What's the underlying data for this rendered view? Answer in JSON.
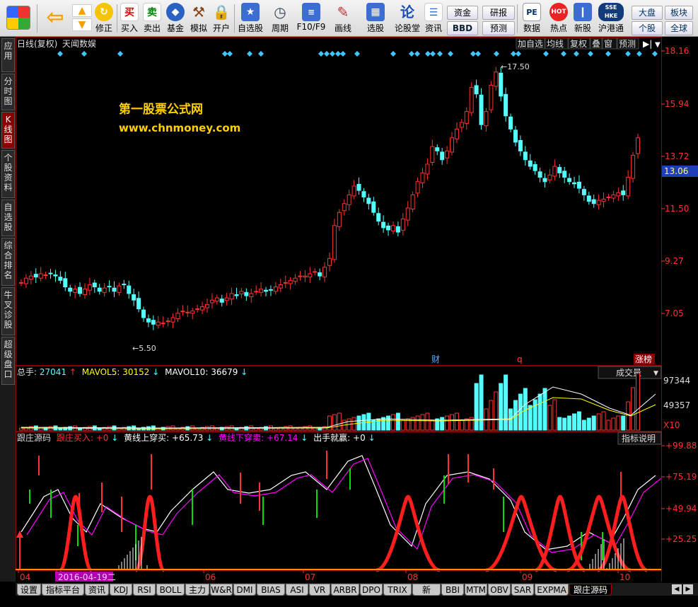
{
  "toolbar": {
    "items": [
      {
        "label": "",
        "icon": "app-logo-icon"
      },
      {
        "label": "",
        "icon": "back-arrow-icon"
      },
      {
        "label": "修正",
        "icon": "refresh-icon"
      },
      {
        "label": "买入",
        "icon": "buy-icon",
        "glyph": "买"
      },
      {
        "label": "卖出",
        "icon": "sell-icon",
        "glyph": "卖"
      },
      {
        "label": "基金",
        "icon": "fund-icon"
      },
      {
        "label": "模拟",
        "icon": "hammer-icon"
      },
      {
        "label": "开户",
        "icon": "lock-icon"
      },
      {
        "label": "自选股",
        "icon": "star-icon"
      },
      {
        "label": "周期",
        "icon": "clock-icon"
      },
      {
        "label": "F10/F9",
        "icon": "f10-icon"
      },
      {
        "label": "画线",
        "icon": "pencil-icon"
      },
      {
        "label": "选股",
        "icon": "stock-select-icon"
      },
      {
        "label": "论股堂",
        "icon": "forum-icon",
        "glyph": "论"
      },
      {
        "label": "资讯",
        "icon": "news-icon"
      },
      {
        "label": "数据",
        "icon": "pe-icon",
        "glyph": "PE"
      },
      {
        "label": "热点",
        "icon": "hot-icon",
        "glyph": "HOT"
      },
      {
        "label": "新股",
        "icon": "new-stock-icon"
      },
      {
        "label": "沪港通",
        "icon": "hk-connect-icon",
        "glyph": "SSE HKE"
      }
    ],
    "small": {
      "zijin": "资金",
      "bbd": "BBD",
      "yanbao": "研报",
      "yuce": "预测",
      "dapan": "大盘",
      "bankuai": "板块",
      "gegu": "个股",
      "quanqiu": "全球"
    }
  },
  "left_tabs": [
    "应用",
    "分时图",
    "K线图",
    "个股资料",
    "自选股",
    "综合排名",
    "牛叉诊股",
    "超级盘口"
  ],
  "header": {
    "left": "日线(复权)",
    "name": "天闻数娱",
    "buttons": [
      "加自选",
      "均线",
      "复权",
      "叠",
      "窗",
      "预测"
    ]
  },
  "watermark": {
    "line1": "第一股票公式网",
    "line2": "www.chnmoney.com"
  },
  "price_axis": [
    "18.16",
    "15.94",
    "13.72",
    "11.50",
    "9.27",
    "7.05"
  ],
  "current_price": "13.06",
  "annotations": {
    "high": "17.50",
    "low": "5.50",
    "cai": "财",
    "q": "q",
    "zhangbang": "涨榜"
  },
  "volume": {
    "label_total": "总手:",
    "total": "27041",
    "ma5_label": "MAVOL5:",
    "ma5": "30152",
    "ma10_label": "MAVOL10:",
    "ma10": "36679",
    "dropdown": "成交量",
    "axis": [
      "97344",
      "49357",
      "X10"
    ]
  },
  "indicator": {
    "name": "跟庄源码",
    "buy_label": "跟庄买入:",
    "buy": "+0",
    "yellow_up_label": "黄线上穿买:",
    "yellow_up": "+65.73",
    "yellow_down_label": "黄线下穿卖:",
    "yellow_down": "+67.14",
    "out_label": "出手就赢:",
    "out": "+0",
    "help": "指标说明",
    "axis": [
      "+99.88",
      "+75.19",
      "+49.94",
      "+25.25"
    ]
  },
  "date_axis": [
    {
      "label": "04"
    },
    {
      "label": "2016-04-19二",
      "highlight": true
    },
    {
      "label": "06"
    },
    {
      "label": "07"
    },
    {
      "label": "08"
    },
    {
      "label": "09"
    },
    {
      "label": "10"
    }
  ],
  "bottom_tabs": [
    "设置",
    "指标平台",
    "资讯",
    "KDJ",
    "RSI",
    "BOLL",
    "主力",
    "W&R",
    "DMI",
    "BIAS",
    "ASI",
    "VR",
    "ARBR",
    "DPO",
    "TRIX",
    "新DMA",
    "BBI",
    "MTM",
    "OBV",
    "SAR",
    "EXPMA",
    "跟庄源码"
  ],
  "colors": {
    "up": "#ff3232",
    "down": "#54ffff",
    "bg": "#000000",
    "grid": "#8b0000",
    "ma5": "#ffffff",
    "ma10": "#ffff00",
    "magenta": "#ff00ff",
    "green": "#00dd00"
  }
}
